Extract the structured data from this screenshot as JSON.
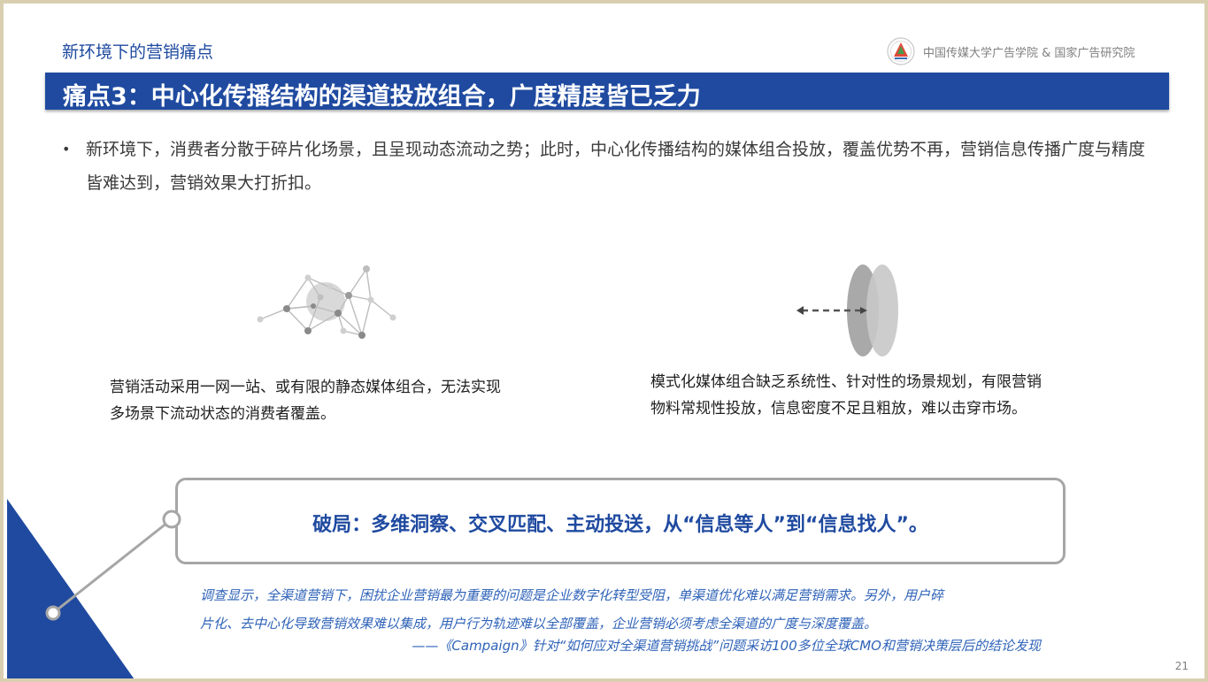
{
  "header": {
    "section_title": "新环境下的营销痛点",
    "institution": "中国传媒大学广告学院 & 国家广告研究院"
  },
  "banner": {
    "title": "痛点3：中心化传播结构的渠道投放组合，广度精度皆已乏力"
  },
  "bullet": {
    "marker": "•",
    "text": "新环境下，消费者分散于碎片化场景，且呈现动态流动之势；此时，中心化传播结构的媒体组合投放，覆盖优势不再，营销信息传播广度与精度皆难达到，营销效果大打折扣。"
  },
  "left_item": {
    "icon": "network-icon",
    "line1": "营销活动采用一网一站、或有限的静态媒体组合，无法实现",
    "line2": "多场景下流动状态的消费者覆盖。"
  },
  "right_item": {
    "icon": "lens-icon",
    "line1": "模式化媒体组合缺乏系统性、针对性的场景规划，有限营销",
    "line2": "物料常规性投放，信息密度不足且粗放，难以击穿市场。"
  },
  "breakout": {
    "text": "破局：多维洞察、交叉匹配、主动投送，从“信息等人”到“信息找人”。"
  },
  "quote": {
    "line1": "调查显示，全渠道营销下，困扰企业营销最为重要的问题是企业数字化转型受阻，单渠道优化难以满足营销需求。另外，用户碎",
    "line2": "片化、去中心化导致营销效果难以集成，用户行为轨迹难以全部覆盖，企业营销必须考虑全渠道的广度与深度覆盖。",
    "source": "——《Campaign》针对“如何应对全渠道营销挑战”问题采访100多位全球CMO和营销决策层后的结论发现"
  },
  "footer": {
    "page_number": "21"
  },
  "colors": {
    "brand_blue": "#1f4aa0",
    "quote_blue": "#2f63b8",
    "frame": "#d9cfb0"
  }
}
